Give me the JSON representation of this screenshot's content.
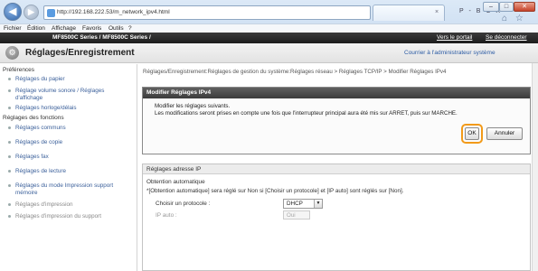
{
  "browser": {
    "address": "http://192.168.222.53/m_network_ipv4.html",
    "address_tools": "P - B C X",
    "tab_close": "×",
    "window_min": "–",
    "window_max": "□",
    "window_close": "✕",
    "home_icons": "⌂ ☆ ⚙",
    "back_arrow": "◀",
    "forward_arrow": "▶",
    "menus": [
      "Fichier",
      "Édition",
      "Affichage",
      "Favoris",
      "Outils",
      "?"
    ]
  },
  "device": {
    "name": "MF8500C Series / MF8500C Series /",
    "link_portal": "Vers le portail",
    "link_logout": "Se déconnecter"
  },
  "header": {
    "icon": "⚙",
    "title": "Réglages/Enregistrement",
    "courier": "Courrier à l'administrateur système"
  },
  "sidebar": {
    "preferences": "Préférences",
    "pref_items": [
      "Réglages du papier",
      "Réglage volume sonore / Réglages d'affichage",
      "Réglages horloge/délais"
    ],
    "functions": "Réglages des fonctions",
    "func_items": [
      "Réglages communs",
      "Réglages de copie",
      "Réglages fax",
      "Réglages de lecture",
      "Réglages du mode Impression support mémoire",
      "Réglages d'impression",
      "Réglages d'impression du support"
    ]
  },
  "main": {
    "breadcrumb": "Réglages/Enregistrement:Réglages de gestion du système:Réglages réseau > Réglages TCP/IP > Modifier Réglages IPv4",
    "dialog": {
      "title": "Modifier Réglages IPv4",
      "msg1": "Modifier les réglages suivants.",
      "msg2": "Les modifications seront prises en compte une fois que l'interrupteur principal aura été mis sur ARRET, puis sur MARCHE.",
      "ok": "OK",
      "cancel": "Annuler"
    },
    "section": {
      "title": "Réglages adresse IP",
      "obtention": "Obtention automatique",
      "note": "*[Obtention automatique] sera réglé sur Non si [Choisir un protocole] et [IP auto] sont réglés sur [Non].",
      "protocol_label": "Choisir un protocole :",
      "protocol_value": "DHCP",
      "autoip_label": "IP auto :",
      "autoip_value": "Oui",
      "dropdown_glyph": "▼"
    }
  }
}
